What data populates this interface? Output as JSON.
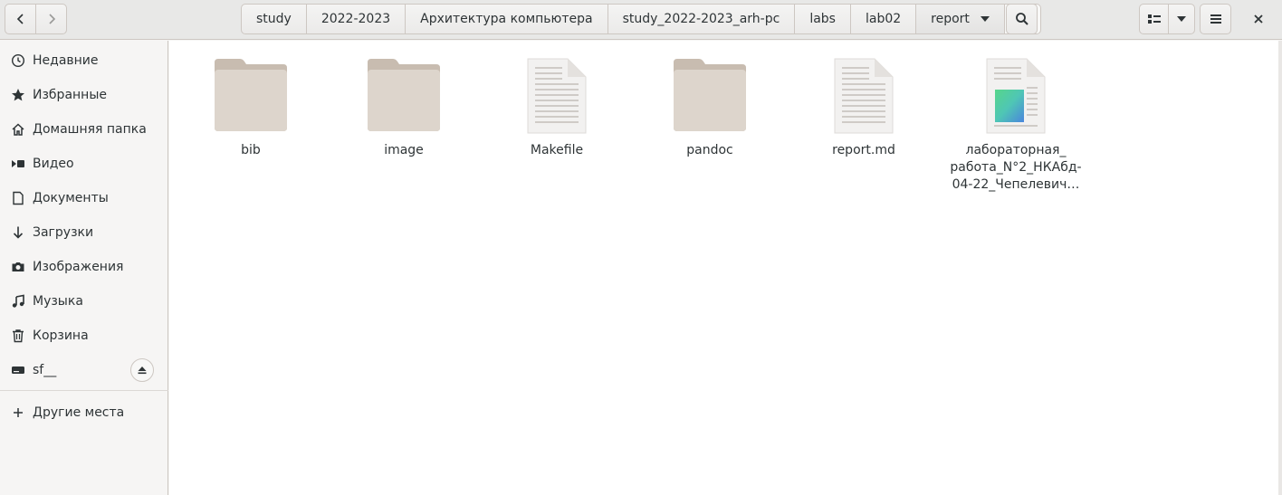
{
  "header": {
    "path": [
      "study",
      "2022-2023",
      "Архитектура компьютера",
      "study_2022-2023_arh-pc",
      "labs",
      "lab02",
      "report"
    ]
  },
  "sidebar": {
    "items": [
      {
        "label": "Недавние",
        "icon": "clock-icon"
      },
      {
        "label": "Избранные",
        "icon": "star-icon"
      },
      {
        "label": "Домашняя папка",
        "icon": "home-icon"
      },
      {
        "label": "Видео",
        "icon": "video-icon"
      },
      {
        "label": "Документы",
        "icon": "document-icon"
      },
      {
        "label": "Загрузки",
        "icon": "download-icon"
      },
      {
        "label": "Изображения",
        "icon": "camera-icon"
      },
      {
        "label": "Музыка",
        "icon": "music-icon"
      },
      {
        "label": "Корзина",
        "icon": "trash-icon"
      },
      {
        "label": "sf__",
        "icon": "drive-icon"
      }
    ],
    "other_places": "Другие места"
  },
  "files": [
    {
      "name": "bib",
      "type": "folder"
    },
    {
      "name": "image",
      "type": "folder"
    },
    {
      "name": "Makefile",
      "type": "text"
    },
    {
      "name": "pandoc",
      "type": "folder"
    },
    {
      "name": "report.md",
      "type": "text"
    },
    {
      "name": "лабораторная_ работа_N°2_НКАбд-04-22_Чепелевич…",
      "type": "document-image"
    }
  ],
  "colors": {
    "folder": "#d8cfc6",
    "folder_tab": "#c8bcb0",
    "text_page": "#f2f1f0"
  }
}
